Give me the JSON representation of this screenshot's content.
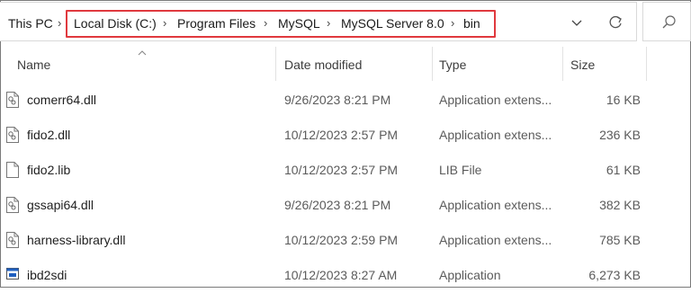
{
  "breadcrumb": {
    "root": "This PC",
    "parts": [
      "Local Disk (C:)",
      "Program Files",
      "MySQL",
      "MySQL Server 8.0",
      "bin"
    ]
  },
  "columns": {
    "name": "Name",
    "date": "Date modified",
    "type": "Type",
    "size": "Size"
  },
  "files": [
    {
      "name": "comerr64.dll",
      "date": "9/26/2023 8:21 PM",
      "type": "Application extens...",
      "size": "16 KB",
      "icon": "dll-file-icon"
    },
    {
      "name": "fido2.dll",
      "date": "10/12/2023 2:57 PM",
      "type": "Application extens...",
      "size": "236 KB",
      "icon": "dll-file-icon"
    },
    {
      "name": "fido2.lib",
      "date": "10/12/2023 2:57 PM",
      "type": "LIB File",
      "size": "61 KB",
      "icon": "blank-file-icon"
    },
    {
      "name": "gssapi64.dll",
      "date": "9/26/2023 8:21 PM",
      "type": "Application extens...",
      "size": "382 KB",
      "icon": "dll-file-icon"
    },
    {
      "name": "harness-library.dll",
      "date": "10/12/2023 2:59 PM",
      "type": "Application extens...",
      "size": "785 KB",
      "icon": "dll-file-icon"
    },
    {
      "name": "ibd2sdi",
      "date": "10/12/2023 8:27 AM",
      "type": "Application",
      "size": "6,273 KB",
      "icon": "exe-file-icon"
    }
  ],
  "colors": {
    "highlight": "#e0393e",
    "accent": "#1f5fbf"
  }
}
